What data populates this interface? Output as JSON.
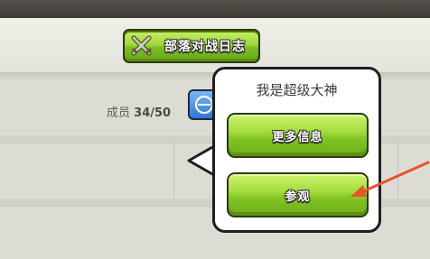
{
  "header": {
    "war_log_label": "部落对战日志",
    "war_log_icon": "crossed-swords-icon"
  },
  "members": {
    "label": "成员",
    "count": "34/50"
  },
  "popup": {
    "title": "我是超级大神",
    "more_info_label": "更多信息",
    "visit_label": "参观"
  },
  "colors": {
    "button_green": "#8fd02c",
    "popup_border": "#1e1e1e",
    "annotation_arrow": "#e8532a",
    "toggle_blue": "#2f78cf"
  }
}
